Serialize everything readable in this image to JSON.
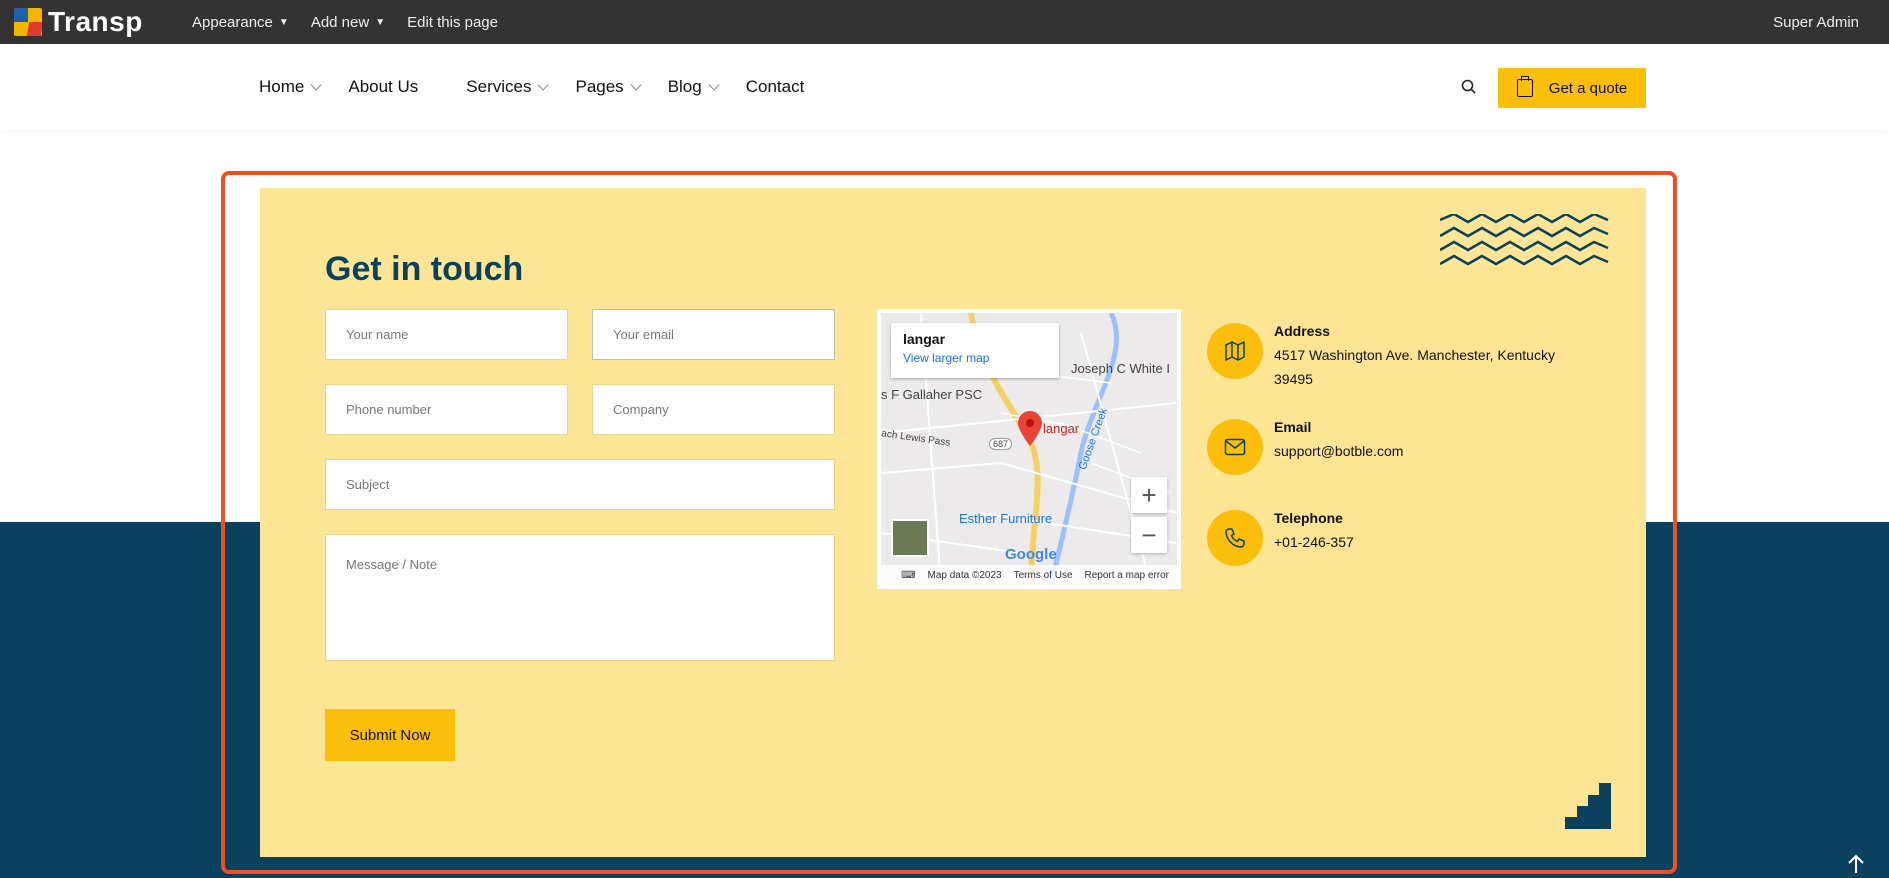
{
  "adminbar": {
    "brand": "Transp",
    "menu": [
      {
        "label": "Appearance",
        "has_caret": true
      },
      {
        "label": "Add new",
        "has_caret": true
      },
      {
        "label": "Edit this page",
        "has_caret": false
      }
    ],
    "user": "Super Admin"
  },
  "nav": {
    "items": [
      {
        "label": "Home",
        "has_dropdown": true
      },
      {
        "label": "About Us",
        "has_dropdown": false
      },
      {
        "label": "Services",
        "has_dropdown": true
      },
      {
        "label": "Pages",
        "has_dropdown": true
      },
      {
        "label": "Blog",
        "has_dropdown": true
      },
      {
        "label": "Contact",
        "has_dropdown": false
      }
    ],
    "search_icon": "search-icon",
    "quote_label": "Get a quote"
  },
  "contact": {
    "title": "Get in touch",
    "form": {
      "name_placeholder": "Your name",
      "email_placeholder": "Your email",
      "phone_placeholder": "Phone number",
      "company_placeholder": "Company",
      "subject_placeholder": "Subject",
      "message_placeholder": "Message / Note",
      "submit_label": "Submit Now"
    },
    "map": {
      "place_name": "langar",
      "larger_map_link": "View larger map",
      "pin_label": "langar",
      "labels": [
        "Joseph C White I",
        "s F Gallaher PSC",
        "Esther Furniture",
        "ach Lewis Pass",
        "Goose Creek",
        "687"
      ],
      "footer": [
        "Map data ©2023",
        "Terms of Use",
        "Report a map error"
      ],
      "logo": "Google"
    },
    "info": [
      {
        "label": "Address",
        "value": "4517 Washington Ave. Manchester, Kentucky 39495",
        "icon": "map-icon"
      },
      {
        "label": "Email",
        "value": "support@botble.com",
        "icon": "mail-icon"
      },
      {
        "label": "Telephone",
        "value": "+01-246-357",
        "icon": "phone-icon"
      }
    ]
  },
  "colors": {
    "accent": "#fbbf0b",
    "navy": "#0a425e",
    "card": "#fde596",
    "highlight": "#f04e23",
    "adminbar": "#333333"
  }
}
